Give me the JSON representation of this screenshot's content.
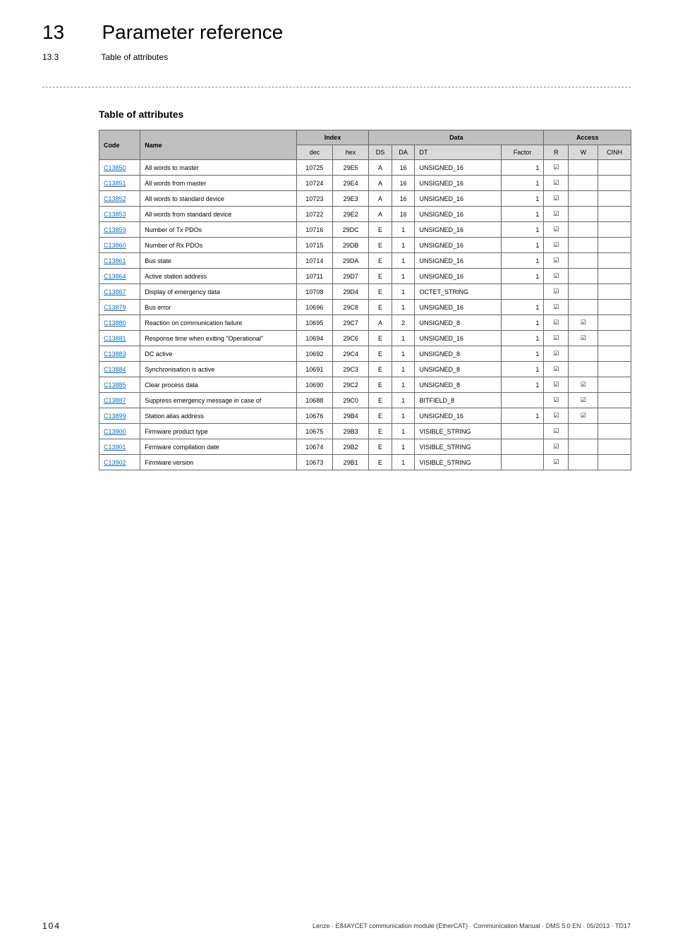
{
  "header": {
    "chapter_num": "13",
    "chapter_title": "Parameter reference",
    "section_num": "13.3",
    "section_title": "Table of attributes"
  },
  "table_title": "Table of attributes",
  "columns": {
    "code": "Code",
    "name": "Name",
    "index": "Index",
    "data": "Data",
    "access": "Access",
    "dec": "dec",
    "hex": "hex",
    "ds": "DS",
    "da": "DA",
    "dt": "DT",
    "factor": "Factor",
    "r": "R",
    "w": "W",
    "cinh": "CINH"
  },
  "rows": [
    {
      "code": "C13850",
      "name": "All words to master",
      "dec": "10725",
      "hex": "29E5",
      "ds": "A",
      "da": "16",
      "dt": "UNSIGNED_16",
      "factor": "1",
      "r": "☑",
      "w": "",
      "cinh": ""
    },
    {
      "code": "C13851",
      "name": "All words from master",
      "dec": "10724",
      "hex": "29E4",
      "ds": "A",
      "da": "16",
      "dt": "UNSIGNED_16",
      "factor": "1",
      "r": "☑",
      "w": "",
      "cinh": ""
    },
    {
      "code": "C13852",
      "name": "All words to standard device",
      "dec": "10723",
      "hex": "29E3",
      "ds": "A",
      "da": "16",
      "dt": "UNSIGNED_16",
      "factor": "1",
      "r": "☑",
      "w": "",
      "cinh": ""
    },
    {
      "code": "C13853",
      "name": "All words from standard device",
      "dec": "10722",
      "hex": "29E2",
      "ds": "A",
      "da": "16",
      "dt": "UNSIGNED_16",
      "factor": "1",
      "r": "☑",
      "w": "",
      "cinh": ""
    },
    {
      "code": "C13859",
      "name": "Number of Tx PDOs",
      "dec": "10716",
      "hex": "29DC",
      "ds": "E",
      "da": "1",
      "dt": "UNSIGNED_16",
      "factor": "1",
      "r": "☑",
      "w": "",
      "cinh": ""
    },
    {
      "code": "C13860",
      "name": "Number of Rx PDOs",
      "dec": "10715",
      "hex": "29DB",
      "ds": "E",
      "da": "1",
      "dt": "UNSIGNED_16",
      "factor": "1",
      "r": "☑",
      "w": "",
      "cinh": ""
    },
    {
      "code": "C13861",
      "name": "Bus state",
      "dec": "10714",
      "hex": "29DA",
      "ds": "E",
      "da": "1",
      "dt": "UNSIGNED_16",
      "factor": "1",
      "r": "☑",
      "w": "",
      "cinh": ""
    },
    {
      "code": "C13864",
      "name": "Active station address",
      "dec": "10711",
      "hex": "29D7",
      "ds": "E",
      "da": "1",
      "dt": "UNSIGNED_16",
      "factor": "1",
      "r": "☑",
      "w": "",
      "cinh": ""
    },
    {
      "code": "C13867",
      "name": "Display of emergency data",
      "dec": "10708",
      "hex": "29D4",
      "ds": "E",
      "da": "1",
      "dt": "OCTET_STRING",
      "factor": "",
      "r": "☑",
      "w": "",
      "cinh": ""
    },
    {
      "code": "C13879",
      "name": "Bus error",
      "dec": "10696",
      "hex": "29C8",
      "ds": "E",
      "da": "1",
      "dt": "UNSIGNED_16",
      "factor": "1",
      "r": "☑",
      "w": "",
      "cinh": ""
    },
    {
      "code": "C13880",
      "name": "Reaction on communication failure",
      "dec": "10695",
      "hex": "29C7",
      "ds": "A",
      "da": "2",
      "dt": "UNSIGNED_8",
      "factor": "1",
      "r": "☑",
      "w": "☑",
      "cinh": ""
    },
    {
      "code": "C13881",
      "name": "Response time when exiting \"Operational\"",
      "dec": "10694",
      "hex": "29C6",
      "ds": "E",
      "da": "1",
      "dt": "UNSIGNED_16",
      "factor": "1",
      "r": "☑",
      "w": "☑",
      "cinh": ""
    },
    {
      "code": "C13883",
      "name": "DC active",
      "dec": "10692",
      "hex": "29C4",
      "ds": "E",
      "da": "1",
      "dt": "UNSIGNED_8",
      "factor": "1",
      "r": "☑",
      "w": "",
      "cinh": ""
    },
    {
      "code": "C13884",
      "name": "Synchronisation is active",
      "dec": "10691",
      "hex": "29C3",
      "ds": "E",
      "da": "1",
      "dt": "UNSIGNED_8",
      "factor": "1",
      "r": "☑",
      "w": "",
      "cinh": ""
    },
    {
      "code": "C13885",
      "name": "Clear process data",
      "dec": "10690",
      "hex": "29C2",
      "ds": "E",
      "da": "1",
      "dt": "UNSIGNED_8",
      "factor": "1",
      "r": "☑",
      "w": "☑",
      "cinh": ""
    },
    {
      "code": "C13887",
      "name": "Suppress emergency message in case of",
      "dec": "10688",
      "hex": "29C0",
      "ds": "E",
      "da": "1",
      "dt": "BITFIELD_8",
      "factor": "",
      "r": "☑",
      "w": "☑",
      "cinh": ""
    },
    {
      "code": "C13899",
      "name": "Station alias address",
      "dec": "10676",
      "hex": "29B4",
      "ds": "E",
      "da": "1",
      "dt": "UNSIGNED_16",
      "factor": "1",
      "r": "☑",
      "w": "☑",
      "cinh": ""
    },
    {
      "code": "C13900",
      "name": "Firmware product type",
      "dec": "10675",
      "hex": "29B3",
      "ds": "E",
      "da": "1",
      "dt": "VISIBLE_STRING",
      "factor": "",
      "r": "☑",
      "w": "",
      "cinh": ""
    },
    {
      "code": "C13901",
      "name": "Firmware compilation date",
      "dec": "10674",
      "hex": "29B2",
      "ds": "E",
      "da": "1",
      "dt": "VISIBLE_STRING",
      "factor": "",
      "r": "☑",
      "w": "",
      "cinh": ""
    },
    {
      "code": "C13902",
      "name": "Firmware version",
      "dec": "10673",
      "hex": "29B1",
      "ds": "E",
      "da": "1",
      "dt": "VISIBLE_STRING",
      "factor": "",
      "r": "☑",
      "w": "",
      "cinh": ""
    }
  ],
  "footer": {
    "page_num": "104",
    "text": "Lenze · E84AYCET communication module (EtherCAT) · Communication Manual · DMS 5.0 EN · 05/2013 · TD17"
  }
}
